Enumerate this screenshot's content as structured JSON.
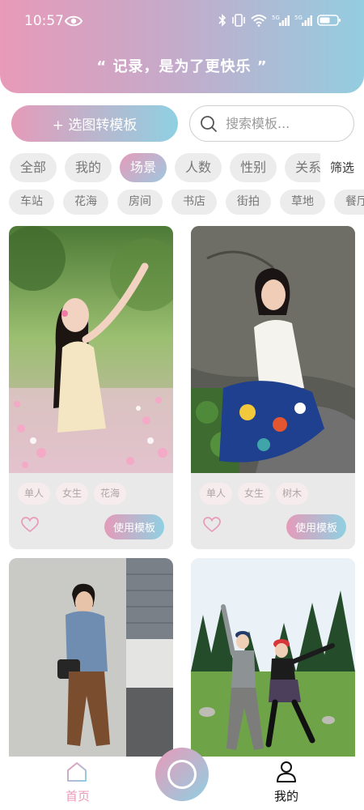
{
  "status_bar": {
    "time": "10:57",
    "icons": [
      "eye-icon",
      "bluetooth-icon",
      "vibrate-icon",
      "wifi-icon",
      "signal-5g-icon",
      "signal-5g-icon",
      "battery-icon"
    ],
    "network_label_1": "5G",
    "network_label_2": "5G"
  },
  "header": {
    "slogan": "“ 记录，是为了更快乐 ”"
  },
  "actions": {
    "convert_label": "+ 选图转模板",
    "search_placeholder": "搜索模板..."
  },
  "categories": {
    "items": [
      "全部",
      "我的",
      "场景",
      "人数",
      "性别",
      "关系"
    ],
    "active": "场景",
    "filter_label": "筛选"
  },
  "subcategories": [
    "车站",
    "花海",
    "房间",
    "书店",
    "街拍",
    "草地",
    "餐厅"
  ],
  "cards": [
    {
      "tags": [
        "单人",
        "女生",
        "花海"
      ],
      "button_label": "使用模板",
      "image": "woman-in-flower-field-photo"
    },
    {
      "tags": [
        "单人",
        "女生",
        "树木"
      ],
      "button_label": "使用模板",
      "image": "woman-sitting-on-rock-photo"
    },
    {
      "image": "man-leaning-on-wall-photo"
    },
    {
      "image": "two-women-on-grass-photo"
    }
  ],
  "bottom_nav": {
    "home_label": "首页",
    "mine_label": "我的",
    "active": "首页"
  },
  "colors": {
    "brand_pink": "#e89ab8",
    "brand_blue": "#8fcfe2",
    "chip_bg": "#ececec",
    "card_bg": "#e9e9e9"
  }
}
